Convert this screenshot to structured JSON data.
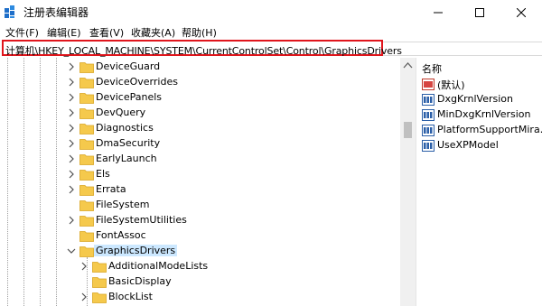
{
  "window": {
    "title": "注册表编辑器"
  },
  "menu": [
    "文件(F)",
    "编辑(E)",
    "查看(V)",
    "收藏夹(A)",
    "帮助(H)"
  ],
  "address": "计算机\\HKEY_LOCAL_MACHINE\\SYSTEM\\CurrentControlSet\\Control\\GraphicsDrivers",
  "tree": {
    "items": [
      {
        "label": "DeviceGuard",
        "expandable": true
      },
      {
        "label": "DeviceOverrides",
        "expandable": true
      },
      {
        "label": "DevicePanels",
        "expandable": true
      },
      {
        "label": "DevQuery",
        "expandable": true
      },
      {
        "label": "Diagnostics",
        "expandable": true
      },
      {
        "label": "DmaSecurity",
        "expandable": true
      },
      {
        "label": "EarlyLaunch",
        "expandable": true
      },
      {
        "label": "Els",
        "expandable": true
      },
      {
        "label": "Errata",
        "expandable": true
      },
      {
        "label": "FileSystem",
        "expandable": false
      },
      {
        "label": "FileSystemUtilities",
        "expandable": true
      },
      {
        "label": "FontAssoc",
        "expandable": false
      },
      {
        "label": "GraphicsDrivers",
        "expandable": true,
        "expanded": true,
        "selected": true
      },
      {
        "label": "AdditionalModeLists",
        "expandable": true,
        "child": true
      },
      {
        "label": "BasicDisplay",
        "expandable": false,
        "child": true
      },
      {
        "label": "BlockList",
        "expandable": true,
        "child": true
      }
    ]
  },
  "values": {
    "column_header": "名称",
    "items": [
      {
        "label": "(默认)",
        "icon": "string-value-icon"
      },
      {
        "label": "DxgKrnlVersion",
        "icon": "dword-value-icon"
      },
      {
        "label": "MinDxgKrnlVersion",
        "icon": "dword-value-icon"
      },
      {
        "label": "PlatformSupportMira…",
        "icon": "dword-value-icon"
      },
      {
        "label": "UseXPModel",
        "icon": "dword-value-icon"
      }
    ]
  },
  "colors": {
    "folder": "#f5c94c",
    "selection": "#cce8ff",
    "highlight_border": "#e0151c",
    "app_icon": "#1f6fc9"
  }
}
